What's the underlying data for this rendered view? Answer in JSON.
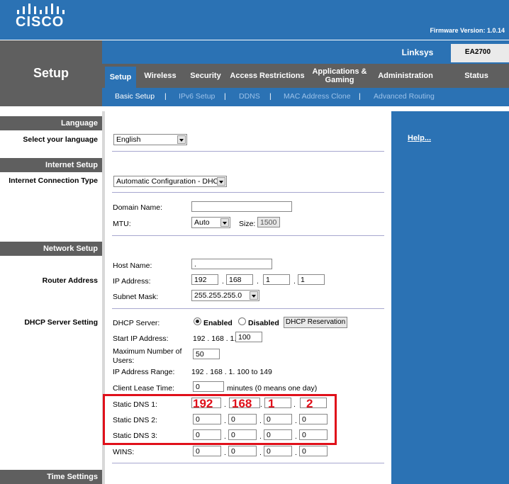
{
  "header": {
    "logo_text": "CISCO",
    "firmware": "Firmware Version: 1.0.14"
  },
  "page_title": "Setup",
  "brand": "Linksys",
  "model": "EA2700",
  "tabs": [
    {
      "label": "Setup",
      "active": true
    },
    {
      "label": "Wireless"
    },
    {
      "label": "Security"
    },
    {
      "label": "Access Restrictions"
    },
    {
      "label": "Applications & Gaming"
    },
    {
      "label": "Administration"
    },
    {
      "label": "Status"
    }
  ],
  "subtabs": [
    {
      "label": "Basic Setup",
      "active": true
    },
    {
      "label": "IPv6 Setup"
    },
    {
      "label": "DDNS"
    },
    {
      "label": "MAC Address Clone"
    },
    {
      "label": "Advanced Routing"
    }
  ],
  "sections": {
    "language": "Language",
    "internet_setup": "Internet Setup",
    "network_setup": "Network Setup",
    "time_settings": "Time Settings"
  },
  "left_labels": {
    "select_language": "Select your language",
    "internet_connection_type": "Internet Connection Type",
    "router_address": "Router Address",
    "dhcp_server_setting": "DHCP Server Setting"
  },
  "help": "Help...",
  "form": {
    "language_value": "English",
    "connection_type_value": "Automatic Configuration - DHCP",
    "domain_name_label": "Domain Name:",
    "domain_name_value": "",
    "mtu_label": "MTU:",
    "mtu_value": "Auto",
    "size_label": "Size:",
    "size_value": "1500",
    "host_name_label": "Host Name:",
    "host_name_value": ".",
    "ip_address_label": "IP Address:",
    "ip": [
      "192",
      "168",
      "1",
      "1"
    ],
    "subnet_mask_label": "Subnet Mask:",
    "subnet_mask_value": "255.255.255.0",
    "dhcp_server_label": "DHCP Server:",
    "enabled_label": "Enabled",
    "disabled_label": "Disabled",
    "dhcp_reservation_label": "DHCP Reservation",
    "start_ip_label": "Start IP  Address:",
    "start_ip_prefix": "192 . 168 . 1.",
    "start_ip_value": "100",
    "max_users_label_1": "Maximum Number of",
    "max_users_label_2": "Users:",
    "max_users_value": "50",
    "ip_range_label": "IP Address Range:",
    "ip_range_value": "192 . 168 . 1. 100 to 149",
    "lease_time_label": "Client Lease Time:",
    "lease_time_value": "0",
    "lease_time_note": "minutes (0 means one day)",
    "dns1_label": "Static DNS 1:",
    "dns1": [
      "192",
      "168",
      "1",
      "2"
    ],
    "dns2_label": "Static DNS 2:",
    "dns2": [
      "0",
      "0",
      "0",
      "0"
    ],
    "dns3_label": "Static DNS 3:",
    "dns3": [
      "0",
      "0",
      "0",
      "0"
    ],
    "wins_label": "WINS:",
    "wins": [
      "0",
      "0",
      "0",
      "0"
    ]
  },
  "colors": {
    "brand_blue": "#2b72b4",
    "nav_gray": "#5f5f5f",
    "highlight_red": "#e0101a"
  }
}
